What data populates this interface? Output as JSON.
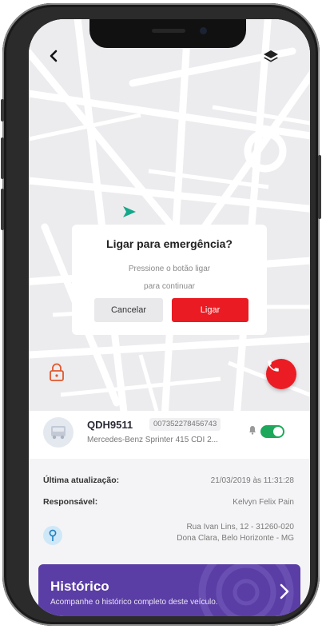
{
  "dialog": {
    "title": "Ligar para emergência?",
    "message_line1": "Pressione o botão ligar",
    "message_line2": "para continuar",
    "cancel_label": "Cancelar",
    "call_label": "Ligar"
  },
  "vehicle": {
    "plate": "QDH9511",
    "tracker_id": "007352278456743",
    "model": "Mercedes-Benz Sprinter 415 CDI 2...",
    "notifications_enabled": true
  },
  "details": {
    "last_update_label": "Última atualização:",
    "last_update_value": "21/03/2019 às 11:31:28",
    "responsible_label": "Responsável:",
    "responsible_value": "Kelvyn Felix Pain",
    "address_line1": "Rua Ivan Lins, 12 - 31260-020",
    "address_line2": "Dona Clara, Belo Horizonte - MG"
  },
  "history": {
    "title": "Histórico",
    "subtitle": "Acompanhe o histórico completo deste veículo."
  },
  "icons": {
    "back": "chevron-left-icon",
    "layers": "layers-icon",
    "location": "navigation-arrow-icon",
    "lock": "lock-icon",
    "phone": "phone-icon",
    "bell": "bell-icon",
    "pin": "map-pin-icon",
    "forward": "chevron-right-icon"
  },
  "colors": {
    "danger": "#ea1b22",
    "success": "#1ea85c",
    "brand_purple": "#5b3ea5",
    "location_marker": "#13a88a"
  }
}
